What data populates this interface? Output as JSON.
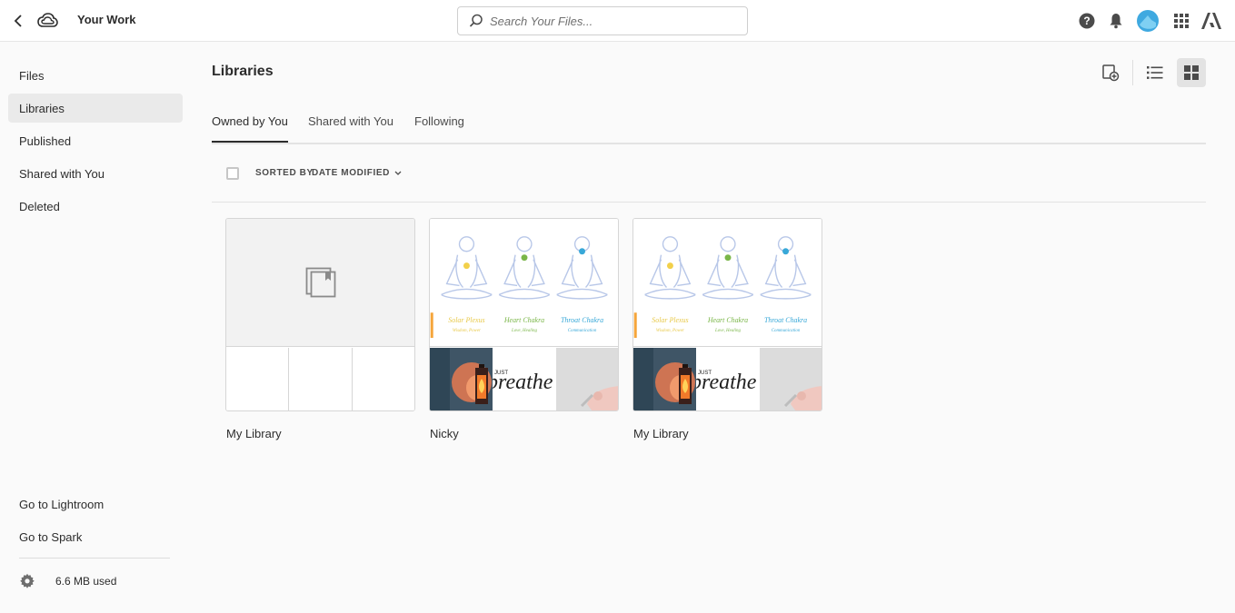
{
  "header": {
    "title": "Your Work",
    "search_placeholder": "Search Your Files..."
  },
  "sidebar": {
    "items": [
      {
        "label": "Files"
      },
      {
        "label": "Libraries"
      },
      {
        "label": "Published"
      },
      {
        "label": "Shared with You"
      },
      {
        "label": "Deleted"
      }
    ],
    "links": [
      {
        "label": "Go to Lightroom"
      },
      {
        "label": "Go to Spark"
      }
    ],
    "storage": "6.6 MB used"
  },
  "main": {
    "title": "Libraries",
    "tabs": [
      {
        "label": "Owned by You"
      },
      {
        "label": "Shared with You"
      },
      {
        "label": "Following"
      }
    ],
    "sort": {
      "label": "SORTED BY",
      "value": "DATE MODIFIED"
    },
    "libraries": [
      {
        "name": "My Library"
      },
      {
        "name": "Nicky"
      },
      {
        "name": "My Library"
      }
    ],
    "art_text": {
      "solar_title": "Solar Plexus",
      "solar_sub": "Wisdom, Power",
      "heart_title": "Heart Chakra",
      "heart_sub": "Love, Healing",
      "throat_title": "Throat Chakra",
      "throat_sub": "Communication",
      "breathe": "breathe",
      "just": "JUST"
    }
  },
  "colors": {
    "avatar": "#3fa9e0",
    "active_nav_bg": "#eaeaea"
  }
}
